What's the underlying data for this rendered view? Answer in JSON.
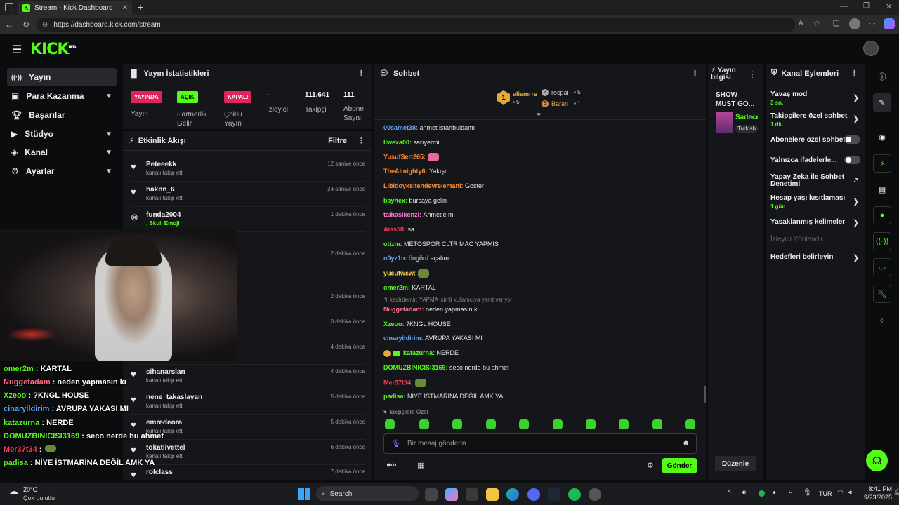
{
  "browser": {
    "tab_title": "Stream - Kick Dashboard",
    "url": "https://dashboard.kick.com/stream",
    "new_tab_symbol": "+"
  },
  "app": {
    "logo": "KICK",
    "logo_badge": "BETA"
  },
  "sidebar": {
    "items": [
      {
        "label": "Yayın",
        "icon": "broadcast-icon",
        "expandable": false
      },
      {
        "label": "Para Kazanma",
        "icon": "money-icon",
        "expandable": true
      },
      {
        "label": "Başarılar",
        "icon": "trophy-icon",
        "expandable": false
      },
      {
        "label": "Stüdyo",
        "icon": "studio-icon",
        "expandable": true
      },
      {
        "label": "Kanal",
        "icon": "channel-icon",
        "expandable": true
      },
      {
        "label": "Ayarlar",
        "icon": "gear-icon",
        "expandable": true
      }
    ]
  },
  "stats": {
    "title": "Yayın İstatistikleri",
    "items": [
      {
        "badge": "YAYINDA",
        "label": "Yayın",
        "badge_color": "#e0245e"
      },
      {
        "badge": "AÇIK",
        "label": "Partnerlik Gelir",
        "badge_color": "#53fc18"
      },
      {
        "badge": "KAPALI",
        "label": "Çoklu Yayın",
        "badge_color": "#e0245e"
      },
      {
        "value": "-",
        "label": "İzleyici"
      },
      {
        "value": "111.641",
        "label": "Takipçi"
      },
      {
        "value": "111",
        "label": "Abone Sayısı"
      }
    ]
  },
  "activity": {
    "title": "Etkinlik Akışı",
    "filter_label": "Filtre",
    "items": [
      {
        "name": "Peteeekk",
        "sub": "kanalı takip etti",
        "time": "12 saniye önce"
      },
      {
        "name": "haknn_6",
        "sub": "kanalı takip etti",
        "time": "24 saniye önce"
      },
      {
        "name": "funda2004",
        "sub": ", Skull Emoji",
        "time": "1 dakika önce",
        "extra": "50"
      },
      {
        "name": "",
        "sub": "",
        "time": "2 dakika önce"
      },
      {
        "name": "",
        "sub": "",
        "time": "2 dakika önce"
      },
      {
        "name": "",
        "sub": "",
        "time": "3 dakika önce"
      },
      {
        "name": "",
        "sub": "",
        "time": "4 dakika önce"
      },
      {
        "name": "cihanarslan",
        "sub": "kanalı takip etti",
        "time": "4 dakika önce"
      },
      {
        "name": "nene_takaslayan",
        "sub": "kanalı takip etti",
        "time": "5 dakika önce"
      },
      {
        "name": "emredeora",
        "sub": "kanalı takip etti",
        "time": "5 dakika önce"
      },
      {
        "name": "tokatlivettel",
        "sub": "kanalı takip etti",
        "time": "6 dakika önce"
      },
      {
        "name": "rolclass",
        "sub": "",
        "time": "7 dakika önce"
      }
    ]
  },
  "chat": {
    "title": "Sohbet",
    "top_gifters": [
      {
        "name": "aliemrre",
        "count": "5",
        "rank": "1"
      },
      {
        "name": "rocpai",
        "count": "5",
        "rank": "2"
      },
      {
        "name": "Baran",
        "count": "1",
        "rank": "3"
      }
    ],
    "messages": [
      {
        "user": "00samet38",
        "text": "ahmet istanbuldamı",
        "color": "#63a9ff"
      },
      {
        "user": "liwexa00",
        "text": "sarıyermi",
        "color": "#53fc18"
      },
      {
        "user": "YusufSert265",
        "text": "",
        "color": "#ff8a34"
      },
      {
        "user": "TheAlmighty6",
        "text": "Yakışır",
        "color": "#ff8a34"
      },
      {
        "user": "Libidoyksltendevrelemani",
        "text": "Goster",
        "color": "#ff8a34"
      },
      {
        "user": "bayhex",
        "text": "bursaya gelin",
        "color": "#53fc18"
      },
      {
        "user": "talhasikenzi",
        "text": "Ahmetle mi",
        "color": "#ff7bd5"
      },
      {
        "user": "Aiss58",
        "text": "sa",
        "color": "#ff3b5b"
      },
      {
        "user": "otizm",
        "text": "METOSPOR CLTR MAC YAPMIS",
        "color": "#53fc18"
      },
      {
        "user": "n0yz1n",
        "text": "öngörü açalım",
        "color": "#63a9ff"
      },
      {
        "user": "yusufwsw",
        "text": "",
        "color": "#ffd84a"
      },
      {
        "user": "omer2m",
        "text": "KARTAL",
        "color": "#53fc18"
      },
      {
        "user": "Nuggetadam",
        "text": "neden yapmasın ki",
        "color": "#ff6b8b",
        "reply": "kadirdemir: YAPMA isimli kullanıcıya yanıt veriyor"
      },
      {
        "user": "Xzeoo",
        "text": "?KNGL HOUSE",
        "color": "#53fc18"
      },
      {
        "user": "cinaryildirim",
        "text": "AVRUPA YAKASI MI",
        "color": "#63a9ff"
      },
      {
        "user": "katazurna",
        "text": "NERDE",
        "color": "#53fc18"
      },
      {
        "user": "DOMUZBINICISI3169",
        "text": "seco nerde bu ahmet",
        "color": "#53fc18"
      },
      {
        "user": "Mer37t34",
        "text": "",
        "color": "#ff3b5b"
      },
      {
        "user": "padisa",
        "text": "NİYE İSTMARİNA DEĞİL AMK YA",
        "color": "#53fc18"
      }
    ],
    "followers_only": "Takipçilere Özel",
    "input_placeholder": "Bir mesaj gönderin",
    "send_label": "Gönder"
  },
  "stream_info": {
    "title": "Yayın bilgisi",
    "stream_title": "SHOW MUST GO...",
    "category": "Sadece",
    "language": "Turkish",
    "edit_label": "Düzenle"
  },
  "channel_actions": {
    "title": "Kanal Eylemleri",
    "items": [
      {
        "label": "Yavaş mod",
        "sub": "3 sn.",
        "control": "chevron"
      },
      {
        "label": "Takipçilere özel sohbet",
        "sub": "1 dk.",
        "control": "chevron"
      },
      {
        "label": "Abonelere özel sohbet",
        "sub": "",
        "control": "toggle"
      },
      {
        "label": "Yalnızca ifadelerle...",
        "sub": "",
        "control": "toggle"
      },
      {
        "label": "Yapay Zeka ile Sohbet Denetimi",
        "sub": "",
        "control": "external"
      },
      {
        "label": "Hesap yaşı kısıtlaması",
        "sub": "1 gün",
        "control": "chevron"
      },
      {
        "label": "Yasaklanmış kelimeler",
        "sub": "",
        "control": "chevron"
      },
      {
        "label": "İzleyici Yönlendir",
        "sub": "",
        "control": "disabled"
      },
      {
        "label": "Hedefleri belirleyin",
        "sub": "",
        "control": "chevron"
      }
    ]
  },
  "overlay_chat": [
    {
      "user": "omer2m",
      "text": " : KARTAL",
      "color": "#53fc18"
    },
    {
      "user": "Nuggetadam",
      "text": " : neden yapmasın ki",
      "color": "#ff6b8b"
    },
    {
      "user": "Xzeoo",
      "text": " : ?KNGL HOUSE",
      "color": "#53fc18"
    },
    {
      "user": "cinaryildirim",
      "text": " : AVRUPA YAKASI MI",
      "color": "#63a9ff"
    },
    {
      "user": "katazurna",
      "text": " : NERDE",
      "color": "#53fc18"
    },
    {
      "user": "DOMUZBINICISI3169",
      "text": " : seco nerde bu ahmet",
      "color": "#53fc18"
    },
    {
      "user": "Mer37t34",
      "text": " : ",
      "color": "#ff3b5b"
    },
    {
      "user": "padisa",
      "text": " : NİYE İSTMARİNA DEĞİL AMK YA",
      "color": "#53fc18"
    }
  ],
  "taskbar": {
    "weather_temp": "20°C",
    "weather_desc": "Çok bulutlu",
    "search_label": "Search",
    "language": "TUR",
    "time": "8:41 PM",
    "date": "9/23/2025"
  },
  "colors": {
    "accent": "#53fc18",
    "live": "#e0245e"
  }
}
